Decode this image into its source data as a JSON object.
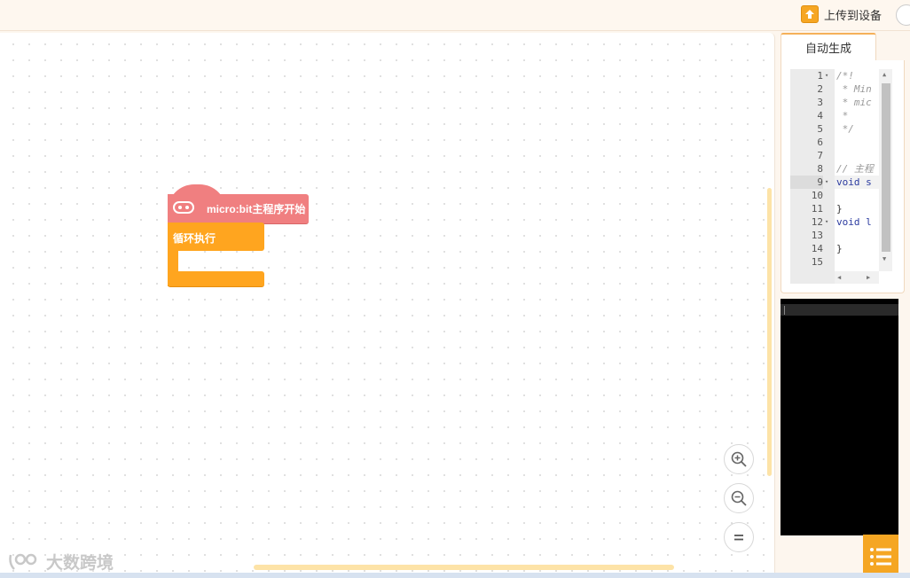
{
  "toolbar": {
    "upload_label": "上传到设备"
  },
  "blocks": {
    "hat_label": "micro:bit主程序开始",
    "loop_label": "循环执行"
  },
  "watermark": {
    "text": "大数跨境"
  },
  "code_panel": {
    "tab_label": "自动生成",
    "lines": [
      {
        "n": "1",
        "fold": "▾",
        "text": "/*!",
        "cls": "cm"
      },
      {
        "n": "2",
        "fold": "",
        "text": " * Min",
        "cls": "cm"
      },
      {
        "n": "3",
        "fold": "",
        "text": " * mic",
        "cls": "cm"
      },
      {
        "n": "4",
        "fold": "",
        "text": " *",
        "cls": "cm"
      },
      {
        "n": "5",
        "fold": "",
        "text": " */",
        "cls": "cm"
      },
      {
        "n": "6",
        "fold": "",
        "text": "",
        "cls": "cm"
      },
      {
        "n": "7",
        "fold": "",
        "text": "",
        "cls": "cm"
      },
      {
        "n": "8",
        "fold": "",
        "text": "// 主程",
        "cls": "cm"
      },
      {
        "n": "9",
        "fold": "▾",
        "text": "void s",
        "cls": "kw"
      },
      {
        "n": "10",
        "fold": "",
        "text": "",
        "cls": "plain"
      },
      {
        "n": "11",
        "fold": "",
        "text": "}",
        "cls": "plain"
      },
      {
        "n": "12",
        "fold": "▾",
        "text": "void l",
        "cls": "kw"
      },
      {
        "n": "13",
        "fold": "",
        "text": "",
        "cls": "plain"
      },
      {
        "n": "14",
        "fold": "",
        "text": "}",
        "cls": "plain"
      },
      {
        "n": "15",
        "fold": "",
        "text": "",
        "cls": "plain"
      }
    ]
  },
  "colors": {
    "hat_block": "#f07f80",
    "loop_block": "#ffa51f",
    "accent": "#f5a623"
  },
  "icons": [
    "upload-icon",
    "microbit-icon",
    "zoom-in-icon",
    "zoom-out-icon",
    "zoom-reset-icon",
    "menu-list-icon"
  ]
}
